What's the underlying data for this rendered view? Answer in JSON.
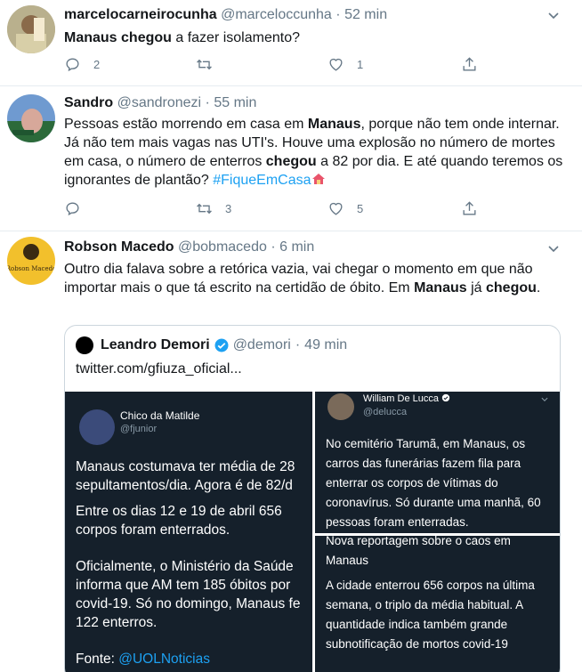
{
  "tweets": [
    {
      "name": "marcelocarneirocunha",
      "handle": "@marceloccunha",
      "sep": "·",
      "time": "52 min",
      "text_bold_1": "Manaus chegou",
      "text_rest_1": " a fazer isolamento?",
      "replies": "2",
      "retweets": "",
      "likes": "1"
    },
    {
      "name": "Sandro",
      "handle": "@sandronezi",
      "sep": "·",
      "time": "55 min",
      "text_1": "Pessoas estão morrendo em casa em ",
      "text_bold_1": "Manaus",
      "text_2": ", porque não tem onde internar. Já não tem mais vagas nas UTI's. Houve uma explosão no número de mortes em casa, o número de enterros ",
      "text_bold_2": "chegou",
      "text_3": " a 82 por dia. E até quando teremos os ignorantes de plantão? ",
      "hashtag": "#FiqueEmCasa",
      "replies": "",
      "retweets": "3",
      "likes": "5"
    },
    {
      "name": "Robson Macedo",
      "handle": "@bobmacedo",
      "sep": "·",
      "time": "6 min",
      "text_1": "Outro dia falava sobre a retórica vazia, vai chegar o momento em que não importar mais o que tá escrito na certidão de óbito. Em ",
      "text_bold_1": "Manaus",
      "text_2": " já ",
      "text_bold_2": "chegou",
      "text_3": ".",
      "avatar_text": "Robson Macedo"
    }
  ],
  "quote": {
    "name": "Leandro Demori",
    "handle": "@demori",
    "sep": "·",
    "time": "49 min",
    "link": "twitter.com/gfiuza_oficial...",
    "left": {
      "name": "Chico da Matilde",
      "handle": "@fjunior",
      "p1": "Manaus costumava ter média de 28 sepultamentos/dia. Agora é de 82/d",
      "p2": "Entre os dias 12 e 19 de abril 656 corpos foram enterrados.",
      "p3": "Oficialmente, o Ministério da Saúde informa que AM tem 185 óbitos por covid-19. Só no domingo, Manaus fe 122 enterros.",
      "fonte_label": "Fonte: ",
      "fonte_link": "@UOLNoticias"
    },
    "right_top": {
      "name": "William De Lucca",
      "handle": "@delucca",
      "text": "No cemitério Tarumã, em Manaus, os carros das funerárias fazem fila para enterrar os corpos de vítimas do coronavírus. Só durante uma manhã, 60 pessoas foram enterradas."
    },
    "right_bottom": {
      "p1": "Nova reportagem sobre o caos em Manaus",
      "p2": "A cidade enterrou 656 corpos na última semana, o triplo da média habitual. A quantidade indica também grande subnotificação de mortos covid-19"
    }
  },
  "icons": {
    "reply": "reply-icon",
    "retweet": "retweet-icon",
    "like": "heart-icon",
    "share": "share-icon",
    "caret": "chevron-down-icon",
    "verified": "verified-badge-icon",
    "house": "house-emoji-icon"
  },
  "colors": {
    "link": "#1da1f2",
    "secondary": "#657786",
    "border": "#e6ecf0",
    "dark_bg": "#15202b"
  }
}
